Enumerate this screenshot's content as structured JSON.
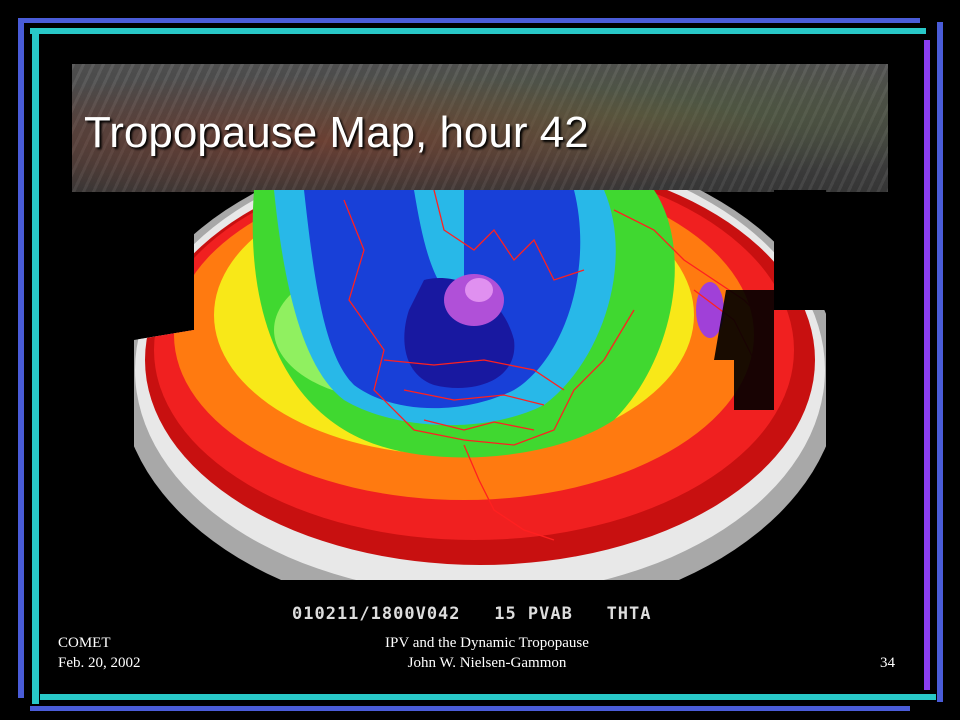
{
  "slide": {
    "title": "Tropopause Map, hour 42",
    "map_label": "010211/1800V042   15 PVAB   THTA",
    "footer": {
      "left_line1": "COMET",
      "left_line2": "Feb. 20, 2002",
      "center_line1": "IPV and the Dynamic Tropopause",
      "center_line2": "John W. Nielsen-Gammon",
      "page_number": "34"
    }
  },
  "colors": {
    "frame_blue": "#4a5cd8",
    "frame_cyan": "#28c8c8",
    "frame_purple": "#8a3ef0",
    "map_outlines": "#ff2020"
  }
}
